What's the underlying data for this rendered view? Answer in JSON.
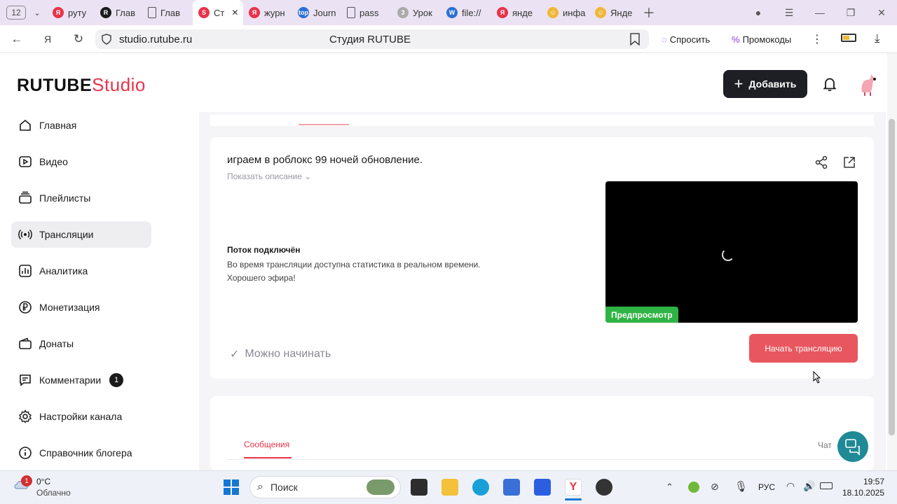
{
  "browser": {
    "tab_count": "12",
    "tabs": [
      {
        "label": "руту",
        "fav": "Я",
        "color": "#e8334a"
      },
      {
        "label": "Глав",
        "fav": "R",
        "color": "#1a1a1a"
      },
      {
        "label": "Глав",
        "fav": "doc",
        "color": "#555"
      },
      {
        "label": "Ст",
        "fav": "S",
        "color": "#e8334a",
        "active": true
      },
      {
        "label": "журн",
        "fav": "Я",
        "color": "#e8334a"
      },
      {
        "label": "Journ",
        "fav": "top",
        "color": "#2b6fd6"
      },
      {
        "label": "pass",
        "fav": "doc",
        "color": "#555"
      },
      {
        "label": "Урок",
        "fav": "3",
        "color": "#aaa"
      },
      {
        "label": "file://",
        "fav": "W",
        "color": "#2b6fd6"
      },
      {
        "label": "янде",
        "fav": "Я",
        "color": "#e8334a"
      },
      {
        "label": "инфа",
        "fav": "☺",
        "color": "#f0b73a"
      },
      {
        "label": "Янде",
        "fav": "☺",
        "color": "#f0b73a"
      }
    ],
    "url": "studio.rutube.ru",
    "page_title": "Студия RUTUBE",
    "ask_label": "Спросить",
    "promo_label": "Промокоды"
  },
  "header": {
    "logo_main": "RUTUBE",
    "logo_studio": "Studio",
    "add_label": "Добавить"
  },
  "sidebar": {
    "items": [
      {
        "label": "Главная",
        "icon": "home-icon"
      },
      {
        "label": "Видео",
        "icon": "video-icon"
      },
      {
        "label": "Плейлисты",
        "icon": "playlist-icon"
      },
      {
        "label": "Трансляции",
        "icon": "broadcast-icon",
        "active": true
      },
      {
        "label": "Аналитика",
        "icon": "analytics-icon"
      },
      {
        "label": "Монетизация",
        "icon": "ruble-icon"
      },
      {
        "label": "Донаты",
        "icon": "wallet-icon"
      },
      {
        "label": "Комментарии",
        "icon": "comment-icon",
        "badge": "1"
      },
      {
        "label": "Настройки канала",
        "icon": "gear-icon"
      },
      {
        "label": "Справочник блогера",
        "icon": "info-icon"
      }
    ]
  },
  "stream": {
    "title": "играем в роблокс 99 ночей обновление.",
    "show_description": "Показать описание",
    "status_title": "Поток подключён",
    "status_line1": "Во время трансляции доступна статистика в реальном времени.",
    "status_line2": "Хорошего эфира!",
    "preview_label": "Предпросмотр",
    "ready_label": "Можно начинать",
    "start_label": "Начать трансляцию"
  },
  "chat": {
    "messages_tab": "Сообщения",
    "chat_label": "Чат"
  },
  "taskbar": {
    "weather_temp": "0°C",
    "weather_desc": "Облачно",
    "weather_badge": "1",
    "search_placeholder": "Поиск",
    "lang": "РУС",
    "time": "19:57",
    "date": "18.10.2025"
  }
}
